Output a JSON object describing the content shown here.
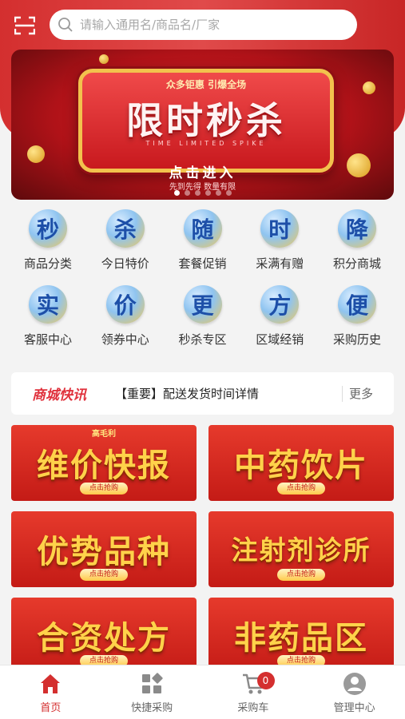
{
  "search": {
    "placeholder": "请输入通用名/商品名/厂家"
  },
  "banner": {
    "subtitle": "众多钜惠 引爆全场",
    "title": "限时秒杀",
    "english": "TIME LIMITED SPIKE",
    "cta": "点击进入",
    "cta_sub": "先到先得 数量有限",
    "slide_count": 6,
    "active_slide": 1
  },
  "categories": [
    {
      "icon_char": "秒",
      "label": "商品分类"
    },
    {
      "icon_char": "杀",
      "label": "今日特价"
    },
    {
      "icon_char": "随",
      "label": "套餐促销"
    },
    {
      "icon_char": "时",
      "label": "采满有赠"
    },
    {
      "icon_char": "降",
      "label": "积分商城"
    },
    {
      "icon_char": "实",
      "label": "客服中心"
    },
    {
      "icon_char": "价",
      "label": "领券中心"
    },
    {
      "icon_char": "更",
      "label": "秒杀专区"
    },
    {
      "icon_char": "方",
      "label": "区域经销"
    },
    {
      "icon_char": "便",
      "label": "采购历史"
    }
  ],
  "news": {
    "logo": "商城快讯",
    "text": "【重要】配送发货时间详情",
    "more": "更多"
  },
  "promos": [
    {
      "title": "维价快报",
      "tag": "高毛利",
      "button": "点击抢购"
    },
    {
      "title": "中药饮片",
      "tag": "",
      "button": "点击抢购"
    },
    {
      "title": "优势品种",
      "tag": "",
      "button": "点击抢购"
    },
    {
      "title": "注射剂诊所",
      "tag": "",
      "button": "点击抢购"
    },
    {
      "title": "合资处方",
      "tag": "",
      "button": "点击抢购"
    },
    {
      "title": "非药品区",
      "tag": "",
      "button": "点击抢购"
    }
  ],
  "tabbar": {
    "items": [
      {
        "label": "首页",
        "icon": "home-icon",
        "active": true
      },
      {
        "label": "快捷采购",
        "icon": "grid-icon",
        "active": false
      },
      {
        "label": "采购车",
        "icon": "cart-icon",
        "active": false,
        "badge": "0"
      },
      {
        "label": "管理中心",
        "icon": "user-icon",
        "active": false
      }
    ]
  },
  "colors": {
    "brand": "#d42f2f",
    "accent": "#ffd24a"
  }
}
